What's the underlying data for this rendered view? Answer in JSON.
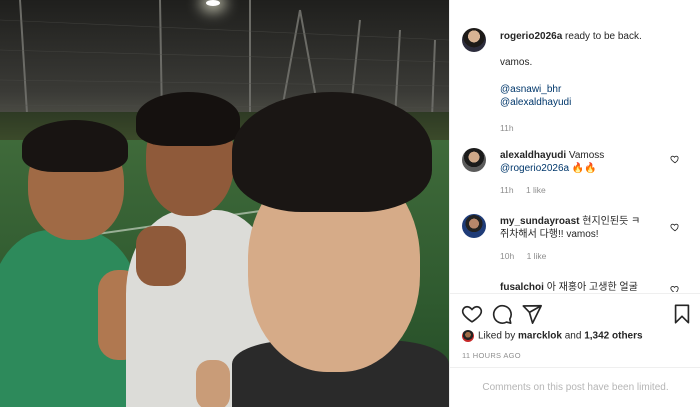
{
  "post": {
    "author": "rogerio2026a",
    "caption_lines": [
      "ready to be back.",
      "vamos."
    ],
    "mentions": [
      "@asnawi_bhr",
      "@alexaldhayudi"
    ],
    "time": "11h"
  },
  "comments": [
    {
      "user": "alexaldhayudi",
      "text": "Vamoss",
      "line2": "@rogerio2026a 🔥🔥",
      "time": "11h",
      "likes": "1 like"
    },
    {
      "user": "my_sundayroast",
      "text": "현지인된듯 ㅋ",
      "line2": "쥐차해서 다행!! vamos!",
      "time": "10h",
      "likes": "1 like"
    },
    {
      "user": "fusalchoi",
      "text": "아 재홍아 고생한 얼굴"
    }
  ],
  "likes": {
    "prefix": "Liked by ",
    "user": "marcklok",
    "middle": " and ",
    "count": "1,342 others"
  },
  "timeago": "11 HOURS AGO",
  "comments_limited": "Comments on this post have been limited.",
  "icons": {
    "like": "heart-icon",
    "comment": "comment-icon",
    "share": "share-icon",
    "save": "bookmark-icon"
  },
  "colors": {
    "link": "#00376b",
    "muted": "#8e8e8e",
    "text": "#262626"
  }
}
